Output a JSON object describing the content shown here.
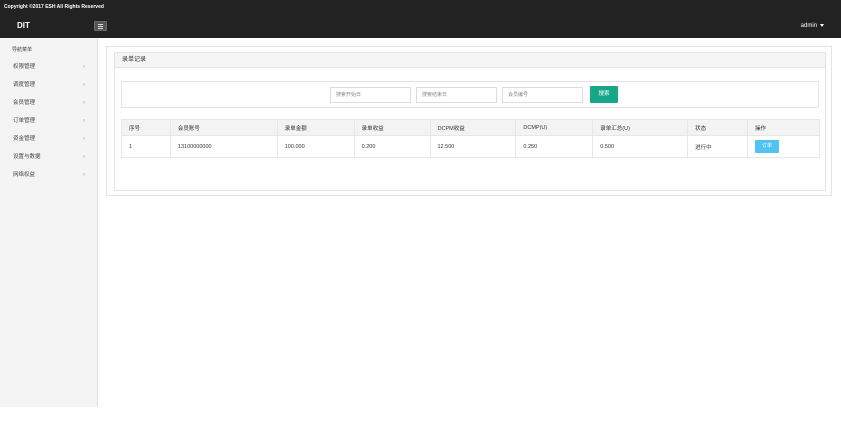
{
  "copyright": "Copyright ©2017 ESH All Rights Reserved",
  "header": {
    "brand": "DIT",
    "menu_icon": "hamburger-icon",
    "user": "admin",
    "user_caret_icon": "caret-down-icon"
  },
  "sidebar": {
    "title": "导航菜单",
    "chevron_icon": "chevron-left-icon",
    "items": [
      {
        "label": "权限管理"
      },
      {
        "label": "调度管理"
      },
      {
        "label": "会员管理"
      },
      {
        "label": "订单管理"
      },
      {
        "label": "资金管理"
      },
      {
        "label": "设置与数据"
      },
      {
        "label": "网络权益"
      }
    ]
  },
  "panel": {
    "title": "录单记录",
    "search": {
      "start_placeholder": "搜索开始日",
      "end_placeholder": "搜索结束日",
      "member_placeholder": "会员编号",
      "button_label": "搜索"
    }
  },
  "table": {
    "columns": [
      "序号",
      "会员账号",
      "录单金额",
      "录单收益",
      "DCPM收益",
      "DCMP(U)",
      "录单汇总(U)",
      "状态",
      "操作"
    ],
    "rows": [
      {
        "index": "1",
        "account": "13100000000",
        "amount": "100.000",
        "profit": "0.200",
        "dcpm": "12.500",
        "dcmp": "0.250",
        "total": "0.500",
        "status": "进行中",
        "action": "订单"
      }
    ]
  },
  "colors": {
    "dark": "#222222",
    "accent": "#18a689",
    "info": "#4fc3f1",
    "sidebar_bg": "#f4f4f4"
  }
}
